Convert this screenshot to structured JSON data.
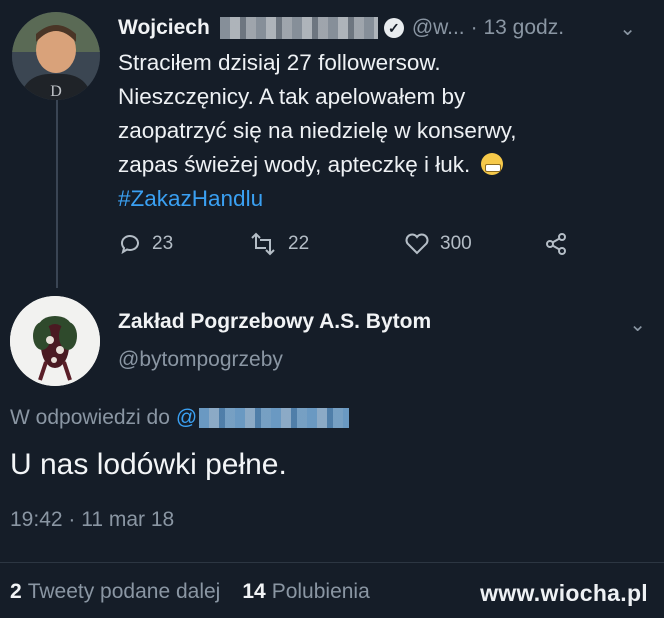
{
  "tweet1": {
    "name": "Wojciech",
    "handle": "@w...",
    "time": "· 13 godz.",
    "lines": [
      "Straciłem dzisiaj 27 followersow.",
      "Nieszczęnicy. A tak apelowałem by",
      "zaopatrzyć się na niedzielę w konserwy,",
      "zapas świeżej wody, apteczkę i łuk."
    ],
    "hashtag": "#ZakazHandlu",
    "actions": {
      "replies": "23",
      "retweets": "22",
      "likes": "300"
    }
  },
  "tweet2": {
    "name": "Zakład Pogrzebowy A.S. Bytom",
    "handle": "@bytompogrzeby",
    "reply_prefix": "W odpowiedzi do",
    "reply_at": "@",
    "text": "U nas lodówki pełne.",
    "timestamp": "19:42 · 11 mar 18",
    "retweet_count": "2",
    "retweet_label": "Tweety podane dalej",
    "like_count": "14",
    "like_label": "Polubienia"
  },
  "watermark": "www.wiocha.pl",
  "icons": {
    "chevron": "chevron-down-icon",
    "verified": "verified-badge-icon",
    "reply": "reply-icon",
    "retweet": "retweet-icon",
    "like": "heart-icon",
    "share": "share-icon"
  }
}
